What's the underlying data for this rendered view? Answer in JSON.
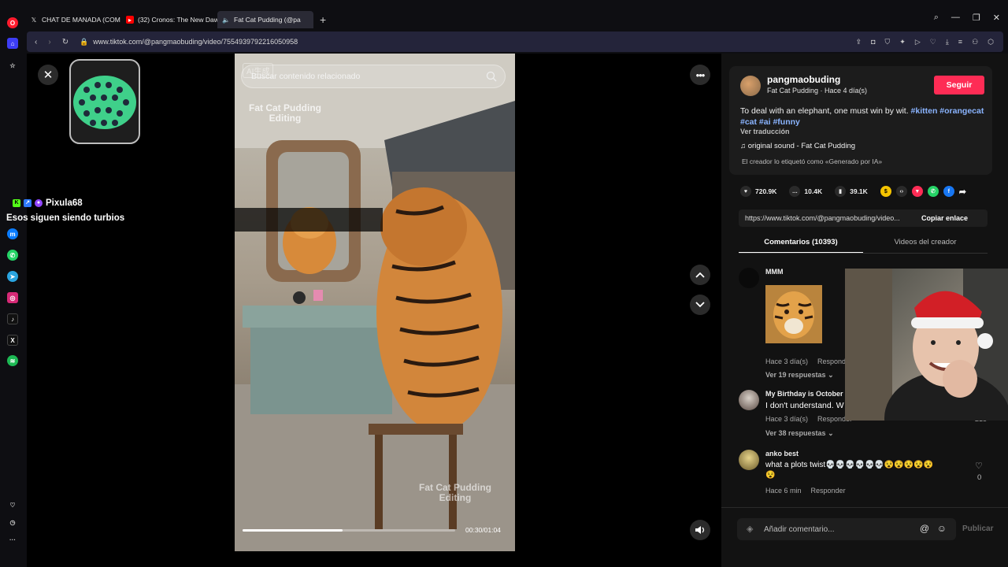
{
  "browser": {
    "tabs": [
      {
        "label": "CHAT DE MANADA (COM",
        "icon": "x-logo"
      },
      {
        "label": "(32) Cronos: The New Daw",
        "icon": "youtube"
      },
      {
        "label": "Fat Cat Pudding (@pa",
        "icon": "tiktok"
      }
    ],
    "url": "www.tiktok.com/@pangmaobuding/video/7554939792216050958"
  },
  "video": {
    "search_placeholder": "Buscar contenido relacionado",
    "watermark_top": "Fat Cat Pudding\nEditing",
    "watermark_bottom": "Fat Cat Pudding\nEditing",
    "ai_badge": "AI生成",
    "timecode": "00:30/01:04",
    "progress": 0.47
  },
  "overlay": {
    "chat_user": "Pixula68",
    "chat_message": "Esos siguen siendo turbios"
  },
  "post": {
    "username": "pangmaobuding",
    "subtitle": "Fat Cat Pudding · Hace 4 día(s)",
    "follow_label": "Seguir",
    "description_text": "To deal with an elephant, one must win by wit. ",
    "description_tags": "#kitten #orangecat #cat #ai #funny",
    "translate_label": "Ver traducción",
    "sound": "original sound - Fat Cat Pudding",
    "ai_label": "El creador lo etiquetó como «Generado por IA»",
    "likes": "720.9K",
    "comments": "10.4K",
    "saves": "39.1K",
    "link": "https://www.tiktok.com/@pangmaobuding/video...",
    "copy_label": "Copiar enlace",
    "tab_comments": "Comentarios (10393)",
    "tab_creator": "Videos del creador"
  },
  "comments": [
    {
      "user": "MMM",
      "text": "",
      "time": "Hace 3 día(s)",
      "reply": "Responder",
      "more": "Ver 19 respuestas"
    },
    {
      "user": "My Birthday is October",
      "text": "I don't understand. W",
      "time": "Hace 3 día(s)",
      "reply": "Responder",
      "more": "Ver 38 respuestas",
      "likes": "215"
    },
    {
      "user": "anko best",
      "text": "what a plots twist💀💀💀💀💀💀😵😵😵😵😵",
      "text2": "😵",
      "time": "Hace 6 min",
      "reply": "Responder",
      "likes": "0"
    }
  ],
  "composer": {
    "placeholder": "Añadir comentario...",
    "publish": "Publicar"
  },
  "colors": {
    "accent": "#fe2c55",
    "tag": "#8ab4ff",
    "opera_red": "#ff1b2d"
  }
}
